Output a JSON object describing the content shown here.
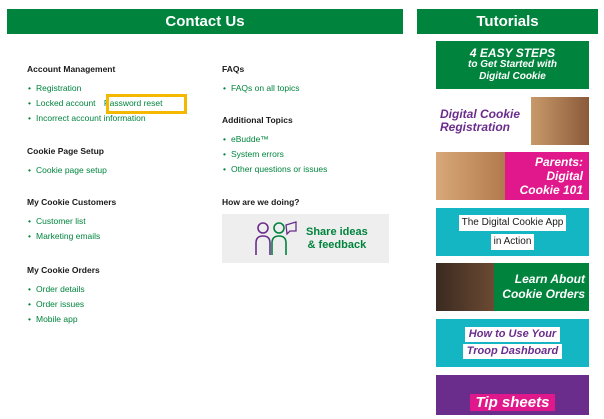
{
  "contact": {
    "title": "Contact Us",
    "account": {
      "heading": "Account Management",
      "links": [
        "Registration",
        "Locked account",
        "Password reset",
        "Incorrect account information"
      ]
    },
    "cookie_page": {
      "heading": "Cookie Page Setup",
      "links": [
        "Cookie page setup"
      ]
    },
    "customers": {
      "heading": "My Cookie Customers",
      "links": [
        "Customer list",
        "Marketing emails"
      ]
    },
    "orders": {
      "heading": "My Cookie Orders",
      "links": [
        "Order details",
        "Order issues",
        "Mobile app"
      ]
    },
    "faqs": {
      "heading": "FAQs",
      "links": [
        "FAQs on all topics"
      ]
    },
    "additional": {
      "heading": "Additional Topics",
      "links": [
        "eBudde™",
        "System errors",
        "Other questions or issues"
      ]
    },
    "feedback": {
      "heading": "How are we doing?",
      "line1": "Share ideas",
      "line2": "& feedback"
    }
  },
  "tutorials": {
    "title": "Tutorials",
    "tiles": [
      {
        "l1": "4 EASY STEPS",
        "l2": "to Get Started with",
        "l3": "Digital Cookie"
      },
      {
        "l1": "Digital Cookie",
        "l2": "Registration"
      },
      {
        "l1": "Parents:",
        "l2": "Digital",
        "l3": "Cookie 101"
      },
      {
        "l1": "The Digital Cookie App",
        "l2": "in Action"
      },
      {
        "l1": "Learn About",
        "l2": "Cookie Orders"
      },
      {
        "l1": "How to Use Your",
        "l2": "Troop Dashboard"
      },
      {
        "l1": "Tip sheets"
      }
    ]
  },
  "colors": {
    "brand_green": "#00843d",
    "highlight": "#f5b800",
    "magenta": "#e0188c",
    "teal": "#14b6c4",
    "purple": "#6b2d8c"
  }
}
